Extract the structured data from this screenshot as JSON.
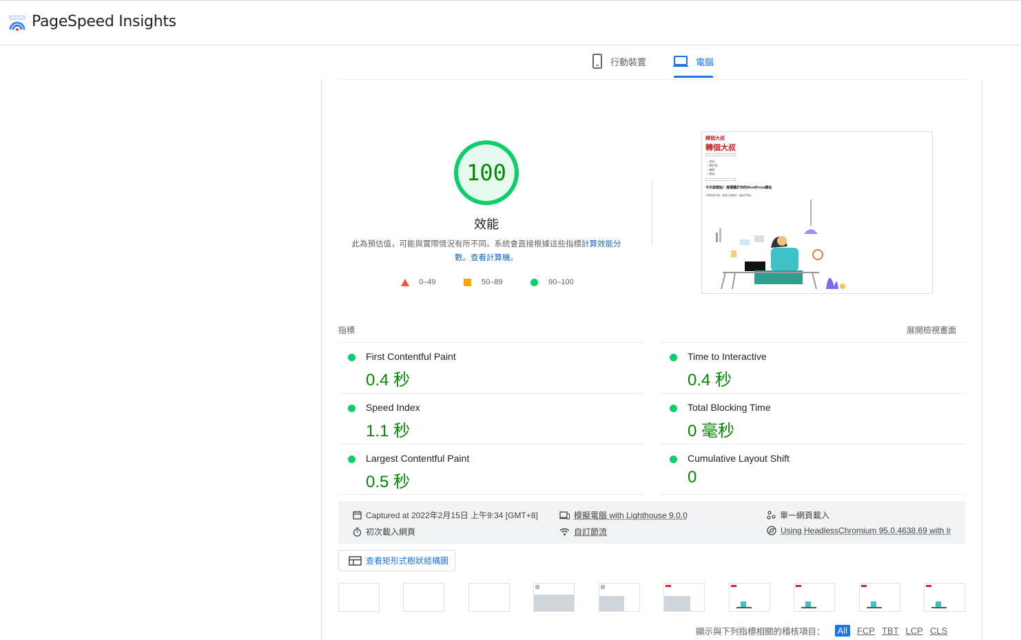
{
  "app": {
    "title": "PageSpeed Insights"
  },
  "tabs": [
    {
      "label": "行動裝置",
      "icon": "smartphone-icon",
      "active": false
    },
    {
      "label": "電腦",
      "icon": "laptop-icon",
      "active": true
    }
  ],
  "score": {
    "value": "100",
    "fraction": 1.0,
    "label": "效能",
    "description_prefix": "此為預估值，可能與實際情況有所不同。系統會直接根據這些指標",
    "link_calc": "計算效能分數",
    "separator": "。",
    "link_calculator": "查看計算機",
    "description_suffix": "。",
    "color": "#0cce6b"
  },
  "legend": [
    {
      "range": "0–49",
      "shape": "triangle",
      "color": "#ff4e42"
    },
    {
      "range": "50–89",
      "shape": "square",
      "color": "#ffa400"
    },
    {
      "range": "90–100",
      "shape": "circle",
      "color": "#0cce6b"
    }
  ],
  "screenshot": {
    "site_name": "轉個大叔",
    "nav_items": [
      "• 首頁",
      "• 關於我",
      "• 聯絡",
      "• 網站"
    ],
    "headline": "今天就開始！建構屬於你的WordPress網站",
    "body_text": "不需寫程式碼，輕鬆打造網站，讓創意落地"
  },
  "metrics": {
    "header": "指標",
    "expand_label": "展開檢視畫面",
    "items": [
      {
        "name": "First Contentful Paint",
        "value": "0.4 秒"
      },
      {
        "name": "Time to Interactive",
        "value": "0.4 秒"
      },
      {
        "name": "Speed Index",
        "value": "1.1 秒"
      },
      {
        "name": "Total Blocking Time",
        "value": "0 毫秒"
      },
      {
        "name": "Largest Contentful Paint",
        "value": "0.5 秒"
      },
      {
        "name": "Cumulative Layout Shift",
        "value": "0"
      }
    ]
  },
  "runtime": {
    "captured": "Captured at 2022年2月15日 上午9:34 [GMT+8]",
    "emulated": "模擬電腦 with Lighthouse 9.0.0",
    "single_load": "單一網頁載入",
    "initial_load": "初次載入網頁",
    "throttling": "自訂節流",
    "browser": "Using HeadlessChromium 95.0.4638.69 with lr"
  },
  "treemap_button": "查看矩形式樹狀結構圖",
  "filter": {
    "label": "顯示與下列指標相關的稽核項目：",
    "chips": [
      "All",
      "FCP",
      "TBT",
      "LCP",
      "CLS"
    ],
    "active": "All"
  }
}
